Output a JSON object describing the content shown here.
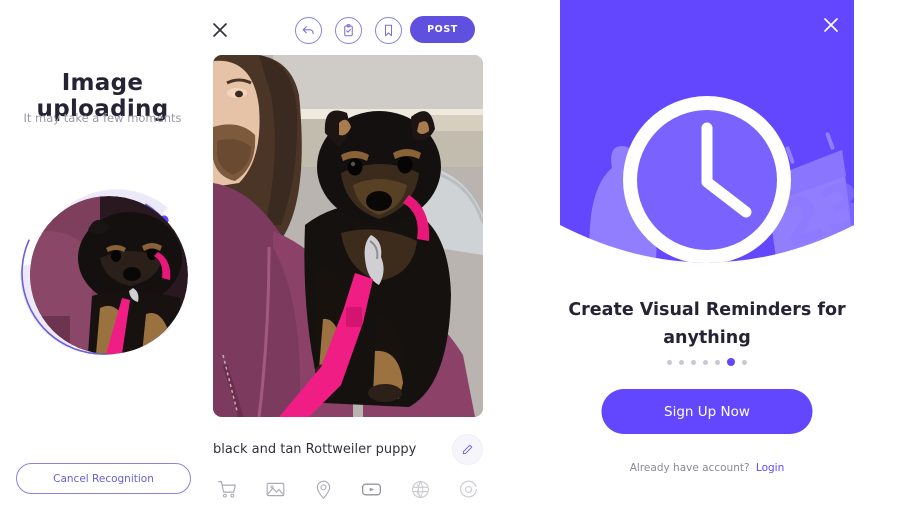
{
  "colors": {
    "accent": "#6247fe",
    "accent_button": "#6050e0",
    "accent_soft": "#8b83e0",
    "text_dark": "#262335",
    "text_muted": "#9a99a5",
    "dot_inactive": "#c9c7d4"
  },
  "upload_panel": {
    "title": "Image uploading",
    "subtitle": "It may take a few moments",
    "progress_percent": 72,
    "thumbnail_alt": "black and tan puppy with pink leash",
    "cancel_button": "Cancel Recognition",
    "ring_icon": "progress-ring-icon"
  },
  "post_panel": {
    "close_icon": "close-icon",
    "toolbar_icons": [
      {
        "name": "undo-icon",
        "label": "Undo"
      },
      {
        "name": "clipboard-check-icon",
        "label": "Tasks"
      },
      {
        "name": "bookmark-icon",
        "label": "Save"
      }
    ],
    "post_button": "POST",
    "photo_alt": "man holding black and tan Rottweiler puppy on pink leash",
    "caption": "black and tan Rottweiler puppy",
    "edit_icon": "pencil-icon",
    "tools": [
      {
        "name": "cart-icon",
        "label": "Shop"
      },
      {
        "name": "image-icon",
        "label": "Photo"
      },
      {
        "name": "location-pin-icon",
        "label": "Location"
      },
      {
        "name": "video-icon",
        "label": "Video"
      },
      {
        "name": "globe-icon",
        "label": "Web"
      },
      {
        "name": "camera-icon",
        "label": "Camera"
      }
    ]
  },
  "onboarding_panel": {
    "close_icon": "close-icon",
    "hero_icon": "alarm-clock-illustration",
    "hero_calendar_day": "23",
    "title": "Create Visual Reminders for anything",
    "dots_total": 7,
    "dots_active_index": 5,
    "signup_button": "Sign Up Now",
    "login_prompt": "Already have account?",
    "login_link": "Login"
  }
}
